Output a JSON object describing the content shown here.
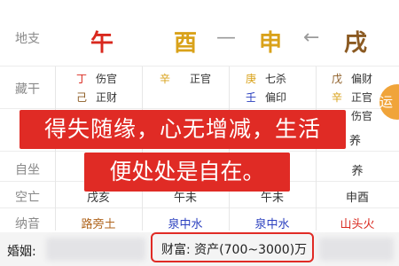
{
  "top_row": {
    "label": "地支",
    "branches": [
      {
        "char": "午",
        "color": "#d9281e"
      },
      {
        "char": "酉",
        "color": "#d9a21a"
      },
      {
        "char": "申",
        "color": "#d9a21a"
      },
      {
        "char": "戌",
        "color": "#8b5a22"
      }
    ],
    "dash_symbol": "—",
    "arrow_symbol": "←"
  },
  "hidden_stems": {
    "label": "藏干",
    "columns": [
      [
        {
          "stem": "丁",
          "stem_color": "#d9281e",
          "god": "伤官"
        },
        {
          "stem": "己",
          "stem_color": "#8b5a22",
          "god": "正财"
        }
      ],
      [
        {
          "stem": "辛",
          "stem_color": "#d9a21a",
          "god": "正官"
        }
      ],
      [
        {
          "stem": "庚",
          "stem_color": "#d9a21a",
          "god": "七杀"
        },
        {
          "stem": "壬",
          "stem_color": "#2a3fbf",
          "god": "偏印"
        }
      ],
      [
        {
          "stem": "戊",
          "stem_color": "#8b5a22",
          "god": "偏财"
        },
        {
          "stem": "辛",
          "stem_color": "#d9a21a",
          "god": "正官"
        },
        {
          "stem": "",
          "stem_color": "#333333",
          "god": "伤官"
        }
      ]
    ]
  },
  "badge": {
    "text": "运"
  },
  "banner": {
    "line1": "得失随缘，心无增减，生活",
    "line2": "便处处是自在。"
  },
  "rows": {
    "partial_char": "养",
    "self_seat": {
      "label": "自坐",
      "value_col4": "养"
    },
    "void": {
      "label": "空亡",
      "col1": "戌亥",
      "col2": "午未",
      "col3": "午未",
      "col4": "申酉"
    },
    "nayin": {
      "label": "纳音",
      "values": [
        {
          "text": "路旁土",
          "color": "#b0651d"
        },
        {
          "text": "泉中水",
          "color": "#2a3fbf"
        },
        {
          "text": "泉中水",
          "color": "#2a3fbf"
        },
        {
          "text": "山头火",
          "color": "#d9281e"
        }
      ]
    }
  },
  "bottom": {
    "marriage_label": "婚姻:",
    "wealth_text": "财富: 资产(700~3000)万"
  }
}
